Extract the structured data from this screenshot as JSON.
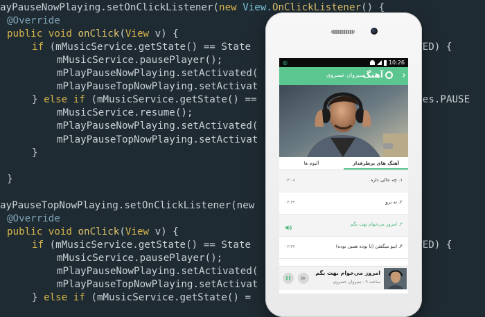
{
  "code": {
    "lines": [
      [
        {
          "t": "ayPauseNowPlaying.setOnClickListener(",
          "c": ""
        },
        {
          "t": "new ",
          "c": "kw"
        },
        {
          "t": "View.",
          "c": "cl"
        },
        {
          "t": "OnClickListener",
          "c": "mt"
        },
        {
          "t": "() {",
          "c": ""
        }
      ],
      [
        {
          "t": "@Override",
          "c": "an"
        }
      ],
      [
        {
          "t": "public ",
          "c": "kw"
        },
        {
          "t": "void ",
          "c": "kw"
        },
        {
          "t": "onClick",
          "c": "mt"
        },
        {
          "t": "(",
          "c": ""
        },
        {
          "t": "View ",
          "c": "kw"
        },
        {
          "t": "v) {",
          "c": ""
        }
      ],
      [
        {
          "t": "if ",
          "c": "kw"
        },
        {
          "t": "(mMusicService.getState() == State",
          "c": ""
        },
        {
          "t": "                         TARTED) {",
          "c": ""
        }
      ],
      [
        {
          "t": "mMusicService.pausePlayer();",
          "c": ""
        }
      ],
      [
        {
          "t": "mPlayPauseNowPlaying.setActivated(",
          "c": ""
        }
      ],
      [
        {
          "t": "mPlayPauseTopNowPlaying.setActivat",
          "c": ""
        }
      ],
      [
        {
          "t": "} ",
          "c": ""
        },
        {
          "t": "else if ",
          "c": "kw"
        },
        {
          "t": "(mMusicService.getState() ==",
          "c": ""
        },
        {
          "t": "                         tates.PAUSE",
          "c": ""
        }
      ],
      [
        {
          "t": "mMusicService.resume();",
          "c": ""
        }
      ],
      [
        {
          "t": "mPlayPauseNowPlaying.setActivated(",
          "c": ""
        }
      ],
      [
        {
          "t": "mPlayPauseTopNowPlaying.setActivat",
          "c": ""
        }
      ],
      [
        {
          "t": "}",
          "c": ""
        }
      ],
      [
        {
          "t": "",
          "c": ""
        }
      ],
      [
        {
          "t": "}",
          "c": ""
        }
      ],
      [
        {
          "t": "",
          "c": ""
        }
      ],
      [
        {
          "t": "ayPauseTopNowPlaying.setOnClickListener(new",
          "c": ""
        },
        {
          "t": "                   {",
          "c": ""
        }
      ],
      [
        {
          "t": "@Override",
          "c": "an"
        }
      ],
      [
        {
          "t": "public ",
          "c": "kw"
        },
        {
          "t": "void ",
          "c": "kw"
        },
        {
          "t": "onClick",
          "c": "mt"
        },
        {
          "t": "(",
          "c": ""
        },
        {
          "t": "View ",
          "c": "kw"
        },
        {
          "t": "v) {",
          "c": ""
        }
      ],
      [
        {
          "t": "if ",
          "c": "kw"
        },
        {
          "t": "(mMusicService.getState() == State",
          "c": ""
        },
        {
          "t": "                         TARTED) {",
          "c": ""
        }
      ],
      [
        {
          "t": "mMusicService.pausePlayer();",
          "c": ""
        }
      ],
      [
        {
          "t": "mPlayPauseNowPlaying.setActivated(",
          "c": ""
        }
      ],
      [
        {
          "t": "mPlayPauseTopNowPlaying.setActivat",
          "c": ""
        }
      ],
      [
        {
          "t": "} ",
          "c": ""
        },
        {
          "t": "else if ",
          "c": "kw"
        },
        {
          "t": "(mMusicService.getState() =",
          "c": ""
        }
      ]
    ]
  },
  "status_bar": {
    "time": "10:26"
  },
  "app_bar": {
    "logo": "آهنگ",
    "artist": "سیروان خسروی"
  },
  "tabs": [
    {
      "label": "آهنگ های پرطرفدار",
      "active": true
    },
    {
      "label": "آلبوم ها",
      "active": false
    }
  ],
  "tracks": [
    {
      "title": "۱. چه حالی داره",
      "duration": "۰۳:۰۸",
      "playing": false
    },
    {
      "title": "۲. نه نرو",
      "duration": "۰۴:۳۲",
      "playing": false
    },
    {
      "title": "۳. امروز می‌خوام بهت بگم",
      "duration": "",
      "playing": true
    },
    {
      "title": "۴. اینو میگفتن (تا بوده همین بوده)",
      "duration": "۰۳:۴۲",
      "playing": false
    }
  ],
  "now_playing": {
    "title": "امروز می‌خوام بهت بگم",
    "subtitle": "ساعت ۹ - سیروان خسروی"
  },
  "colors": {
    "accent": "#5cc690",
    "code_bg": "#1f2b33"
  }
}
